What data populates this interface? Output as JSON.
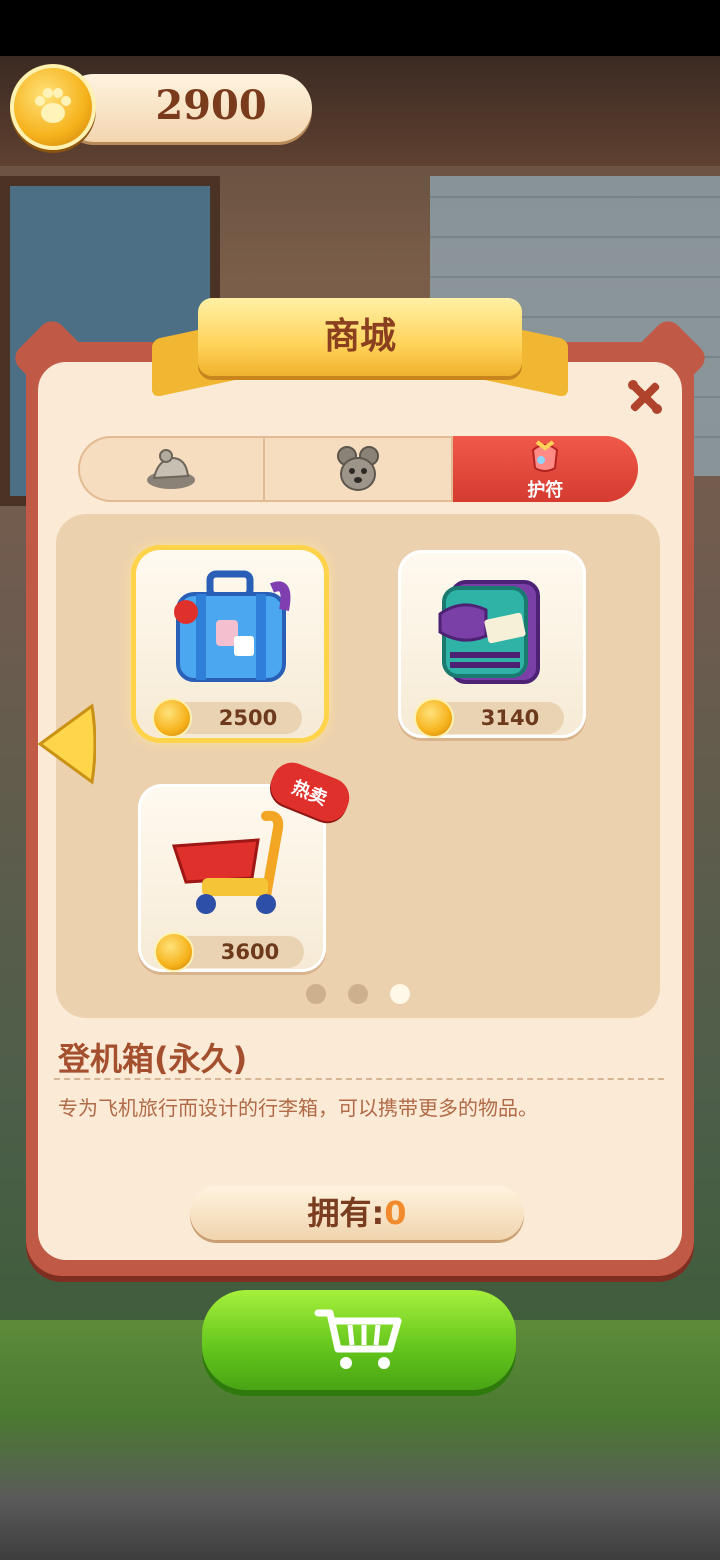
{
  "coins": {
    "amount": "2900"
  },
  "title": "商城",
  "tabs": [
    {
      "icon": "rock-icon",
      "label": ""
    },
    {
      "icon": "mouse-toy-icon",
      "label": ""
    },
    {
      "icon": "amulet-bag-icon",
      "label": "护符",
      "active": true
    }
  ],
  "items": [
    {
      "name": "suitcase",
      "price": "2500",
      "selected": true
    },
    {
      "name": "backpack",
      "price": "3140"
    },
    {
      "name": "shopping-cart",
      "price": "3600",
      "hot_label": "热卖"
    }
  ],
  "pagination": {
    "pages": 3,
    "active": 3
  },
  "detail": {
    "name": "登机箱(永久)",
    "description": "专为飞机旅行而设计的行李箱，可以携带更多的物品。"
  },
  "owned": {
    "label": "拥有:",
    "count": "0"
  },
  "colors": {
    "accent": "#e0302c",
    "panel": "#c05a46",
    "buy": "#62c41c"
  }
}
